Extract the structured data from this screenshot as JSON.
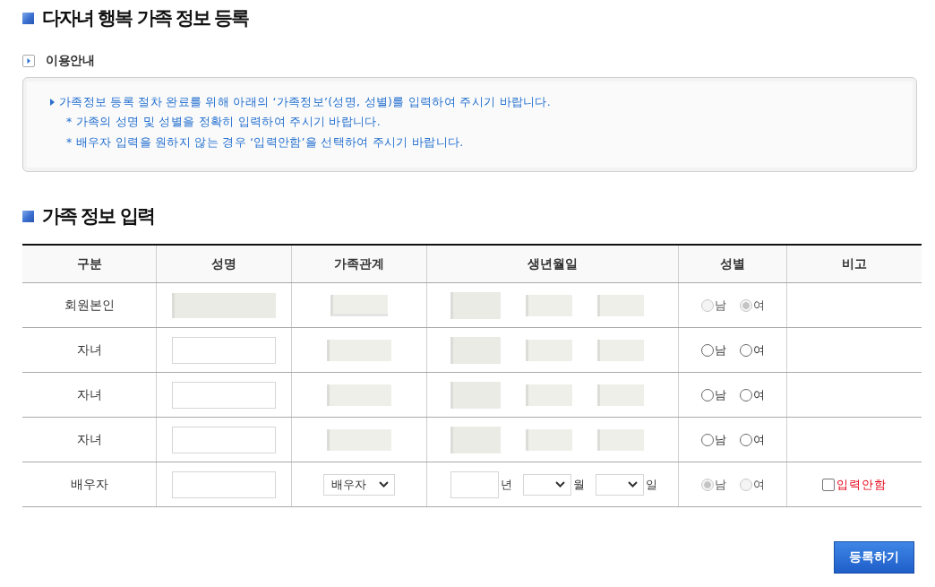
{
  "page_title": "다자녀 행복 가족 정보 등록",
  "guide": {
    "heading": "이용안내",
    "lines": [
      {
        "kind": "main",
        "text": "가족정보 등록 절차 완료를 위해 아래의 ‘가족정보’(성명, 성별)를 입력하여 주시기 바랍니다."
      },
      {
        "kind": "note",
        "text": "* 가족의 성명 및 성별을 정확히 입력하여 주시기 바랍니다."
      },
      {
        "kind": "note",
        "text": "* 배우자 입력을 원하지 않는 경우 ‘입력안함’을 선택하여 주시기 바랍니다."
      }
    ]
  },
  "section_title": "가족 정보 입력",
  "table": {
    "columns": [
      "구분",
      "성명",
      "가족관계",
      "생년월일",
      "성별",
      "비고"
    ],
    "rows": [
      {
        "label": "회원본인",
        "name": {
          "kind": "redacted"
        },
        "relation": {
          "kind": "redacted"
        },
        "birth": {
          "kind": "redacted"
        },
        "gender": [
          {
            "label": "남",
            "selected": false,
            "disabled": true
          },
          {
            "label": "여",
            "selected": true,
            "disabled": true
          }
        ]
      },
      {
        "label": "자녀",
        "name": {
          "kind": "input"
        },
        "relation": {
          "kind": "redacted"
        },
        "birth": {
          "kind": "redacted"
        },
        "gender": [
          {
            "label": "남",
            "selected": false,
            "disabled": false
          },
          {
            "label": "여",
            "selected": false,
            "disabled": false
          }
        ]
      },
      {
        "label": "자녀",
        "name": {
          "kind": "input"
        },
        "relation": {
          "kind": "redacted"
        },
        "birth": {
          "kind": "redacted"
        },
        "gender": [
          {
            "label": "남",
            "selected": false,
            "disabled": false
          },
          {
            "label": "여",
            "selected": false,
            "disabled": false
          }
        ]
      },
      {
        "label": "자녀",
        "name": {
          "kind": "input"
        },
        "relation": {
          "kind": "redacted"
        },
        "birth": {
          "kind": "redacted"
        },
        "gender": [
          {
            "label": "남",
            "selected": false,
            "disabled": false
          },
          {
            "label": "여",
            "selected": false,
            "disabled": false
          }
        ]
      },
      {
        "label": "배우자",
        "name": {
          "kind": "input"
        },
        "relation": {
          "kind": "select",
          "value": "배우자"
        },
        "birth": {
          "kind": "fields",
          "units": [
            "년",
            "월",
            "일"
          ]
        },
        "gender": [
          {
            "label": "남",
            "selected": true,
            "disabled": true
          },
          {
            "label": "여",
            "selected": false,
            "disabled": true
          }
        ],
        "remark": {
          "checked": false,
          "label": "입력안함"
        }
      }
    ]
  },
  "submit_button": "등록하기"
}
